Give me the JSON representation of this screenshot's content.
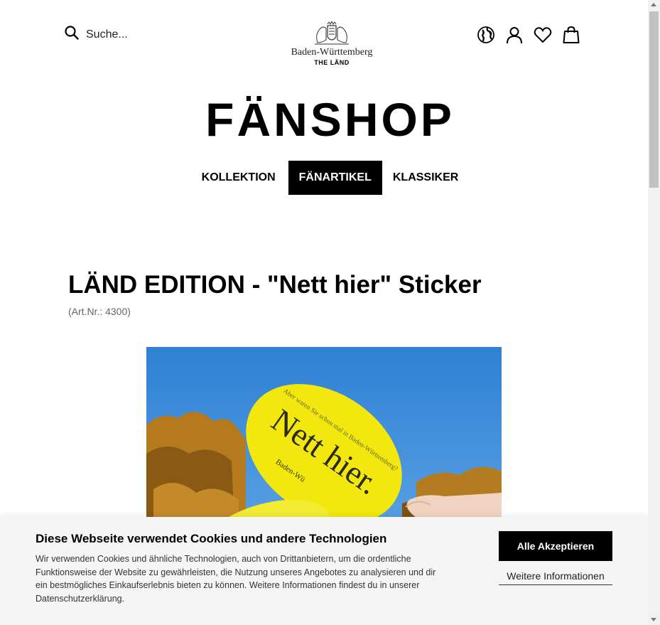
{
  "header": {
    "search": {
      "placeholder": "Suche...",
      "icon": "search-icon"
    },
    "brand": {
      "name": "Baden-Württemberg",
      "claim": "THE LÄND"
    },
    "icons": [
      "globe-icon",
      "user-icon",
      "heart-icon",
      "shopping-bag-icon"
    ]
  },
  "shop_title": "FÄNSHOP",
  "nav": {
    "tabs": [
      {
        "label": "KOLLEKTION",
        "active": false
      },
      {
        "label": "FÄNARTIKEL",
        "active": true
      },
      {
        "label": "KLASSIKER",
        "active": false
      }
    ]
  },
  "product": {
    "title": "LÄND EDITION - \"Nett hier\" Sticker",
    "article_number": "(Art.Nr.: 4300)",
    "image": {
      "sticker_text": "Nett hier.",
      "sticker_subtext": "Aber waren Sie schon mal in Baden-Württemberg?",
      "sticker_brand": "Baden-Wü"
    }
  },
  "cookie_banner": {
    "title": "Diese Webseite verwendet Cookies und andere Technologien",
    "text": "Wir verwenden Cookies und ähnliche Technologien, auch von Drittanbietern, um die ordentliche Funktionsweise der Website zu gewährleisten, die Nutzung unseres Angebotes zu analysieren und dir ein bestmögliches Einkaufserlebnis bieten zu können. Weitere Informationen findest du in unserer Datenschutzerklärung.",
    "accept_label": "Alle Akzeptieren",
    "more_label": "Weitere Informationen"
  },
  "colors": {
    "accent": "#000000",
    "sticker_yellow": "#f2e80f",
    "sky": "#3f8fd8"
  }
}
